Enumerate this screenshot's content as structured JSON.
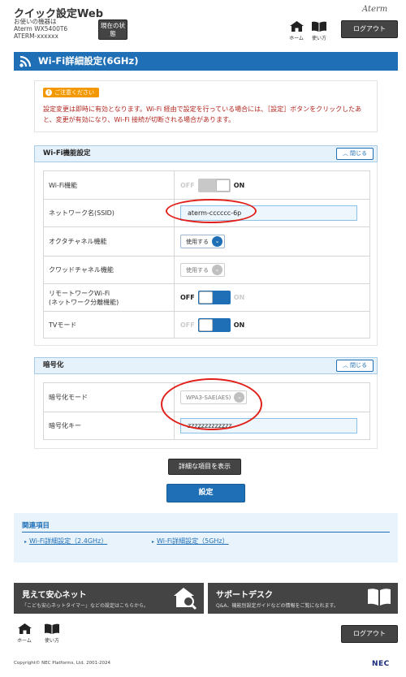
{
  "header": {
    "title": "クイック設定Web",
    "device_label": "お使いの機器は",
    "device_model": "Aterm WX5400T6",
    "device_name": "ATERM-xxxxxx",
    "status_button": "現在の状態",
    "brand": "Aterm",
    "home_label": "ホーム",
    "howto_label": "使い方",
    "logout_label": "ログアウト"
  },
  "page": {
    "title": "Wi-Fi詳細設定(6GHz)"
  },
  "notice": {
    "badge": "ご注意ください",
    "text": "設定変更は即時に有効となります。Wi-Fi 経由で設定を行っている場合には、［設定］ボタンをクリックしたあと、変更が有効になり、Wi-Fi 接続が切断される場合があります。"
  },
  "wifi_section": {
    "title": "Wi-Fi機能設定",
    "close_label": "閉じる",
    "rows": {
      "wifi": {
        "label": "Wi-Fi機能",
        "off": "OFF",
        "on": "ON",
        "state": "ON"
      },
      "ssid": {
        "label": "ネットワーク名(SSID)",
        "value": "aterm-cccccc-6p"
      },
      "octa": {
        "label": "オクタチャネル機能",
        "value": "使用する"
      },
      "quad": {
        "label": "クワッドチャネル機能",
        "value": "使用する"
      },
      "remote": {
        "label1": "リモートワークWi-Fi",
        "label2": "(ネットワーク分離機能)",
        "off": "OFF",
        "on": "ON",
        "state": "OFF"
      },
      "tv": {
        "label": "TVモード",
        "off": "OFF",
        "on": "ON",
        "state": "ON"
      }
    }
  },
  "enc_section": {
    "title": "暗号化",
    "close_label": "閉じる",
    "rows": {
      "mode": {
        "label": "暗号化モード",
        "value": "WPA3-SAE(AES)"
      },
      "key": {
        "label": "暗号化キー",
        "value": "zzzzzzzzzzzzz"
      }
    }
  },
  "actions": {
    "show_details": "詳細な項目を表示",
    "submit": "設定"
  },
  "related": {
    "title": "関連項目",
    "links": [
      "Wi-Fi詳細設定（2.4GHz）",
      "Wi-Fi詳細設定（5GHz）"
    ]
  },
  "banners": {
    "left": {
      "title": "見えて安心ネット",
      "sub": "「こども安心ネットタイマー」などの設定はこちらから。"
    },
    "right": {
      "title": "サポートデスク",
      "sub": "Q&A、機能別設定ガイドなどの情報をご覧になれます。"
    }
  },
  "footer": {
    "copyright": "Copyright© NEC Platforms, Ltd. 2001-2024",
    "nec": "NEC"
  },
  "colors": {
    "accent": "#1f6fb7",
    "notice_text": "#b0251e",
    "badge": "#f39800",
    "annotation": "#e0201a"
  }
}
